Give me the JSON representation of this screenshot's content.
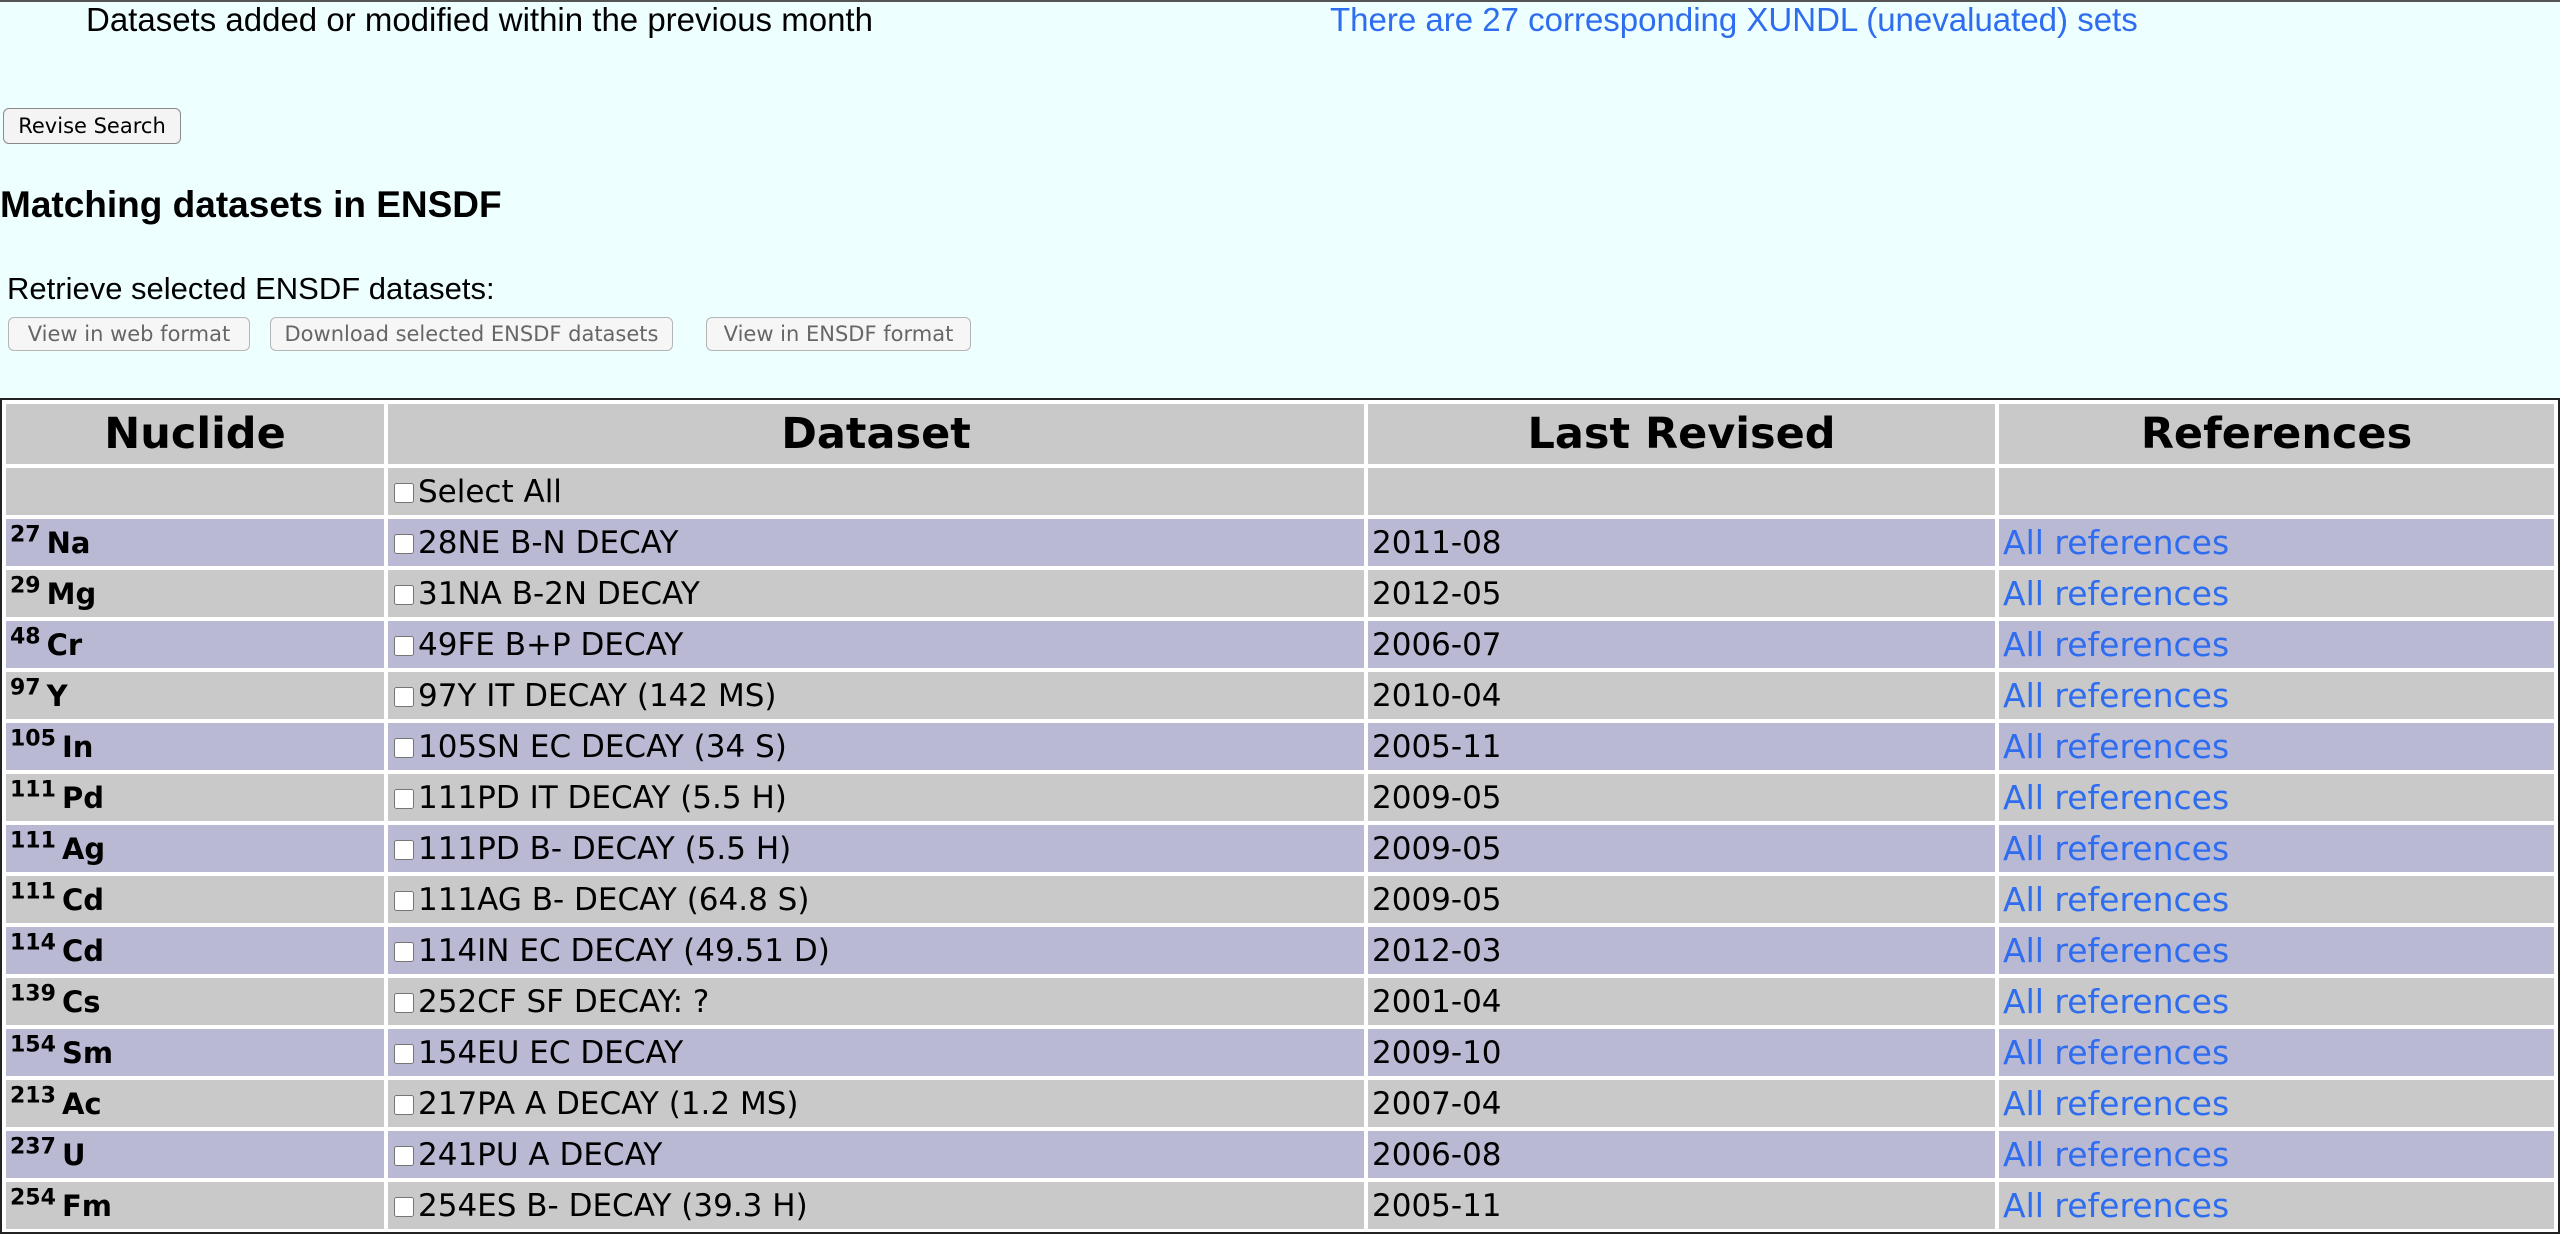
{
  "header": {
    "criteria_text": "Datasets added or modified within the previous month",
    "xundl_link": "There are 27 corresponding XUNDL (unevaluated) sets",
    "link_color": "#2e6cf0"
  },
  "revise_button": "Revise Search",
  "section_title": "Matching datasets in ENSDF",
  "retrieve": {
    "label": "Retrieve selected ENSDF datasets:",
    "buttons": [
      "View in web format",
      "Download selected ENSDF datasets",
      "View in ENSDF format"
    ]
  },
  "table": {
    "columns": [
      "Nuclide",
      "Dataset",
      "Last Revised",
      "References"
    ],
    "select_all_label": "Select All",
    "row_colors": {
      "odd": "#b9b9d3",
      "even": "#c9c9c9"
    },
    "rows": [
      {
        "mass": "27",
        "element": "Na",
        "dataset": "28NE B-N DECAY",
        "revised": "2011-08",
        "ref": "All references"
      },
      {
        "mass": "29",
        "element": "Mg",
        "dataset": "31NA B-2N DECAY",
        "revised": "2012-05",
        "ref": "All references"
      },
      {
        "mass": "48",
        "element": "Cr",
        "dataset": "49FE B+P DECAY",
        "revised": "2006-07",
        "ref": "All references"
      },
      {
        "mass": "97",
        "element": "Y",
        "dataset": "97Y IT DECAY (142 MS)",
        "revised": "2010-04",
        "ref": "All references"
      },
      {
        "mass": "105",
        "element": "In",
        "dataset": "105SN EC DECAY (34 S)",
        "revised": "2005-11",
        "ref": "All references"
      },
      {
        "mass": "111",
        "element": "Pd",
        "dataset": "111PD IT DECAY (5.5 H)",
        "revised": "2009-05",
        "ref": "All references"
      },
      {
        "mass": "111",
        "element": "Ag",
        "dataset": "111PD B- DECAY (5.5 H)",
        "revised": "2009-05",
        "ref": "All references"
      },
      {
        "mass": "111",
        "element": "Cd",
        "dataset": "111AG B- DECAY (64.8 S)",
        "revised": "2009-05",
        "ref": "All references"
      },
      {
        "mass": "114",
        "element": "Cd",
        "dataset": "114IN EC DECAY (49.51 D)",
        "revised": "2012-03",
        "ref": "All references"
      },
      {
        "mass": "139",
        "element": "Cs",
        "dataset": "252CF SF DECAY: ?",
        "revised": "2001-04",
        "ref": "All references"
      },
      {
        "mass": "154",
        "element": "Sm",
        "dataset": "154EU EC DECAY",
        "revised": "2009-10",
        "ref": "All references"
      },
      {
        "mass": "213",
        "element": "Ac",
        "dataset": "217PA A DECAY (1.2 MS)",
        "revised": "2007-04",
        "ref": "All references"
      },
      {
        "mass": "237",
        "element": "U",
        "dataset": "241PU A DECAY",
        "revised": "2006-08",
        "ref": "All references"
      },
      {
        "mass": "254",
        "element": "Fm",
        "dataset": "254ES B- DECAY (39.3 H)",
        "revised": "2005-11",
        "ref": "All references"
      }
    ]
  }
}
